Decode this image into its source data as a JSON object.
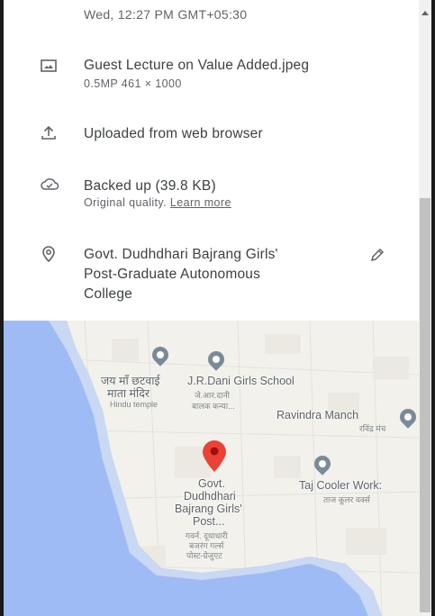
{
  "details": {
    "datetime": "Wed, 12:27 PM   GMT+05:30",
    "file": {
      "icon": "image-icon",
      "name": "Guest Lecture on Value Added.jpeg",
      "meta": "0.5MP   461 × 1000"
    },
    "upload": {
      "icon": "upload-icon",
      "text": "Uploaded from web browser"
    },
    "backup": {
      "icon": "cloud-done-icon",
      "text": "Backed up (39.8 KB)",
      "quality": "Original quality.",
      "learn_more": "Learn more"
    },
    "location": {
      "icon": "location-pin-icon",
      "edit_icon": "edit-pencil-icon",
      "line1": "Govt. Dudhdhari Bajrang Girls'",
      "line2": "Post-Graduate Autonomous",
      "line3": "College"
    }
  },
  "map": {
    "labels": {
      "temple": "जय माँ छटवाई",
      "temple2": "माता मंदिर",
      "temple_en": "Hindu temple",
      "school": "J.R.Dani Girls School",
      "school_hi": "जे.आर.दानी",
      "school_hi2": "बालक कन्या...",
      "ravindra": "Ravindra Manch",
      "ravindra_hi": "रविंद्र मंच",
      "college1": "Govt.",
      "college2": "Dudhdhari",
      "college3": "Bajrang Girls'",
      "college4": "Post...",
      "college_hi1": "गवर्न. दूधाधारी",
      "college_hi2": "बजरंग गर्ल्स",
      "college_hi3": "पोस्ट-ग्रेजुएट",
      "taj": "Taj Cooler Work:",
      "taj_hi": "ताज कूलर वर्क्स"
    },
    "colors": {
      "water": "#9ebbf5",
      "pin": "#ea4335"
    }
  }
}
